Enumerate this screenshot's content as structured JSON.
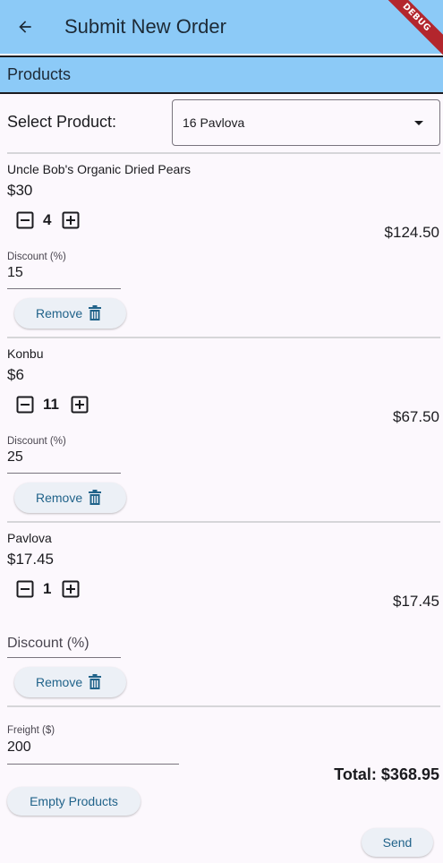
{
  "app_bar": {
    "title": "Submit New Order",
    "debug_label": "DEBUG"
  },
  "section": {
    "title": "Products"
  },
  "select_product": {
    "label": "Select Product:",
    "value": "16 Pavlova"
  },
  "products": [
    {
      "name": "Uncle Bob's Organic Dried Pears",
      "price": "$30",
      "quantity": "4",
      "total": "$124.50",
      "discount_label": "Discount (%)",
      "discount_value": "15",
      "remove_label": "Remove"
    },
    {
      "name": "Konbu",
      "price": "$6",
      "quantity": "11",
      "total": "$67.50",
      "discount_label": "Discount (%)",
      "discount_value": "25",
      "remove_label": "Remove"
    },
    {
      "name": "Pavlova",
      "price": "$17.45",
      "quantity": "1",
      "total": "$17.45",
      "discount_label": "Discount (%)",
      "discount_value": "",
      "remove_label": "Remove"
    }
  ],
  "freight": {
    "label": "Freight ($)",
    "value": "200"
  },
  "total": "Total: $368.95",
  "actions": {
    "empty_label": "Empty Products",
    "send_label": "Send"
  },
  "colors": {
    "app_bar": "#8ccaf7",
    "button_text": "#21638a",
    "button_bg": "#ecf0f6",
    "debug_banner": "#b3262d"
  }
}
